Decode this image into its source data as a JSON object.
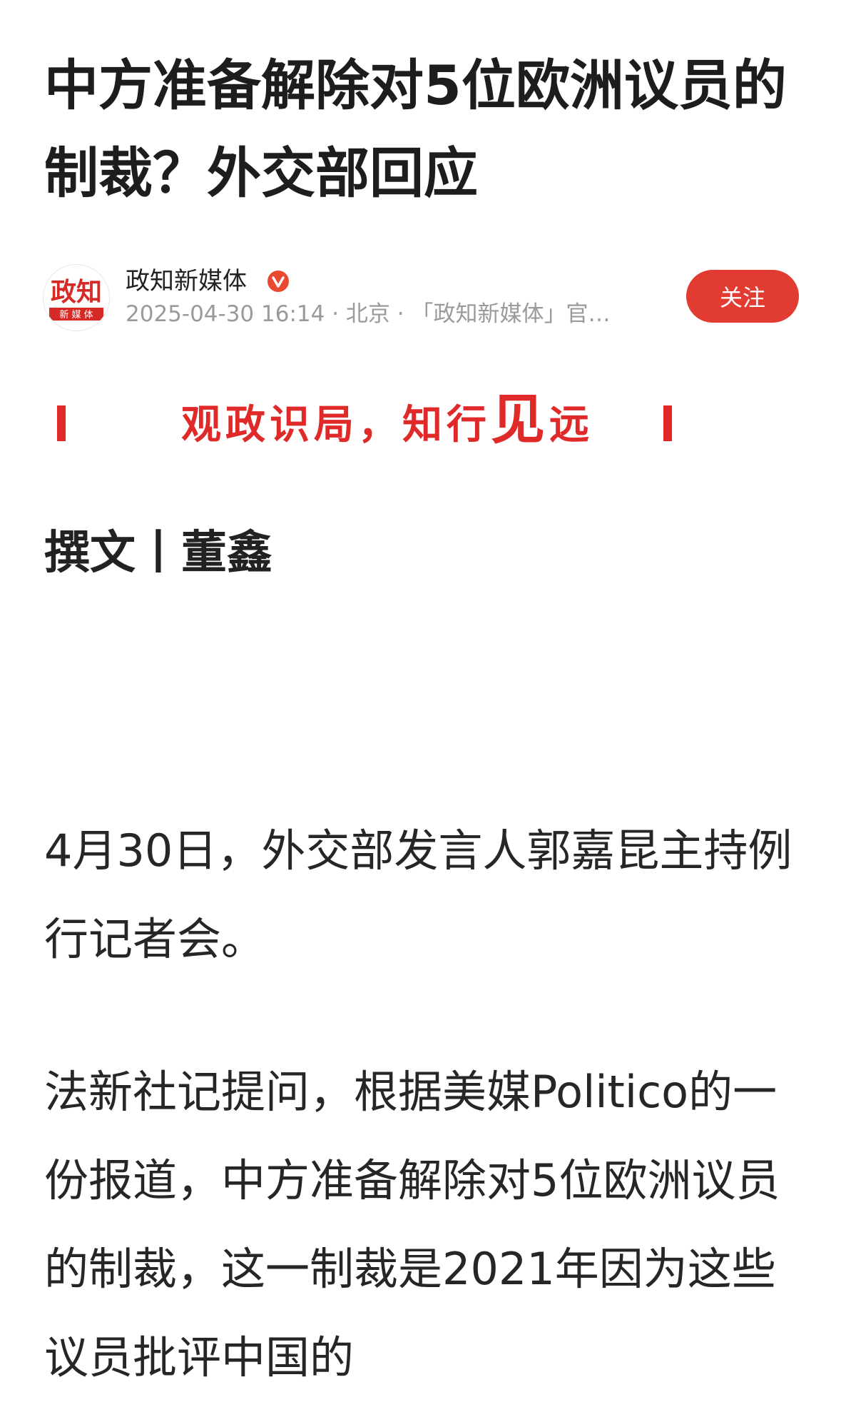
{
  "article": {
    "title": "中方准备解除对5位欧洲议员的制裁？外交部回应",
    "author": {
      "avatar_text": "政知",
      "avatar_subtext": "新 媒 体",
      "name": "政知新媒体",
      "meta": "2025-04-30 16:14 · 北京 · 「政知新媒体」官…",
      "follow_label": "关注"
    },
    "banner": {
      "slogan_part1": "观政识局，知行",
      "slogan_big": "见",
      "slogan_part2": "远"
    },
    "byline": "撰文丨董鑫",
    "paragraphs": [
      "4月30日，外交部发言人郭嘉昆主持例行记者会。",
      "法新社记提问，根据美媒Politico的一份报道，中方准备解除对5位欧洲议员的制裁，这一制裁是2021年因为这些议员批评中国的"
    ]
  },
  "colors": {
    "accent_red": "#e23b32",
    "meta_gray": "#9a9a9a"
  },
  "icons": {
    "verified": "verified-badge-icon"
  }
}
